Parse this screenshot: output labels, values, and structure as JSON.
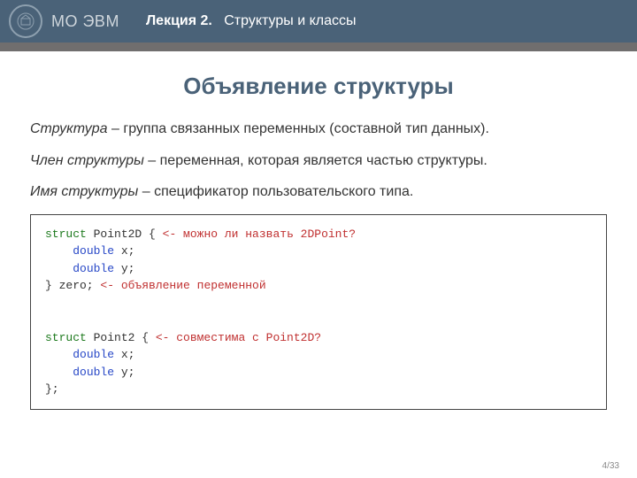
{
  "header": {
    "org": "МО ЭВМ",
    "lecture_prefix": "Лекция 2.",
    "lecture_title": "Структуры и классы"
  },
  "slide": {
    "title": "Объявление структуры",
    "p1_term": "Структура",
    "p1_rest": " – группа связанных переменных (составной тип данных).",
    "p2_term": "Член структуры",
    "p2_rest": " – переменная, которая является частью структуры.",
    "p3_term": "Имя структуры",
    "p3_rest": " – спецификатор пользовательского типа."
  },
  "code": {
    "l1_kw": "struct",
    "l1_name": " Point2D { ",
    "l1_comment": "<- можно ли назвать 2DPoint?",
    "l2_indent": "    ",
    "l2_kw": "double",
    "l2_rest": " x;",
    "l3_indent": "    ",
    "l3_kw": "double",
    "l3_rest": " y;",
    "l4": "} zero; ",
    "l4_comment": "<- объявление переменной",
    "gap": "",
    "l5_kw": "struct",
    "l5_name": " Point2 { ",
    "l5_comment": "<- совместима с Point2D?",
    "l6_indent": "    ",
    "l6_kw": "double",
    "l6_rest": " x;",
    "l7_indent": "    ",
    "l7_kw": "double",
    "l7_rest": " y;",
    "l8": "};"
  },
  "footer": {
    "page": "4/33"
  }
}
